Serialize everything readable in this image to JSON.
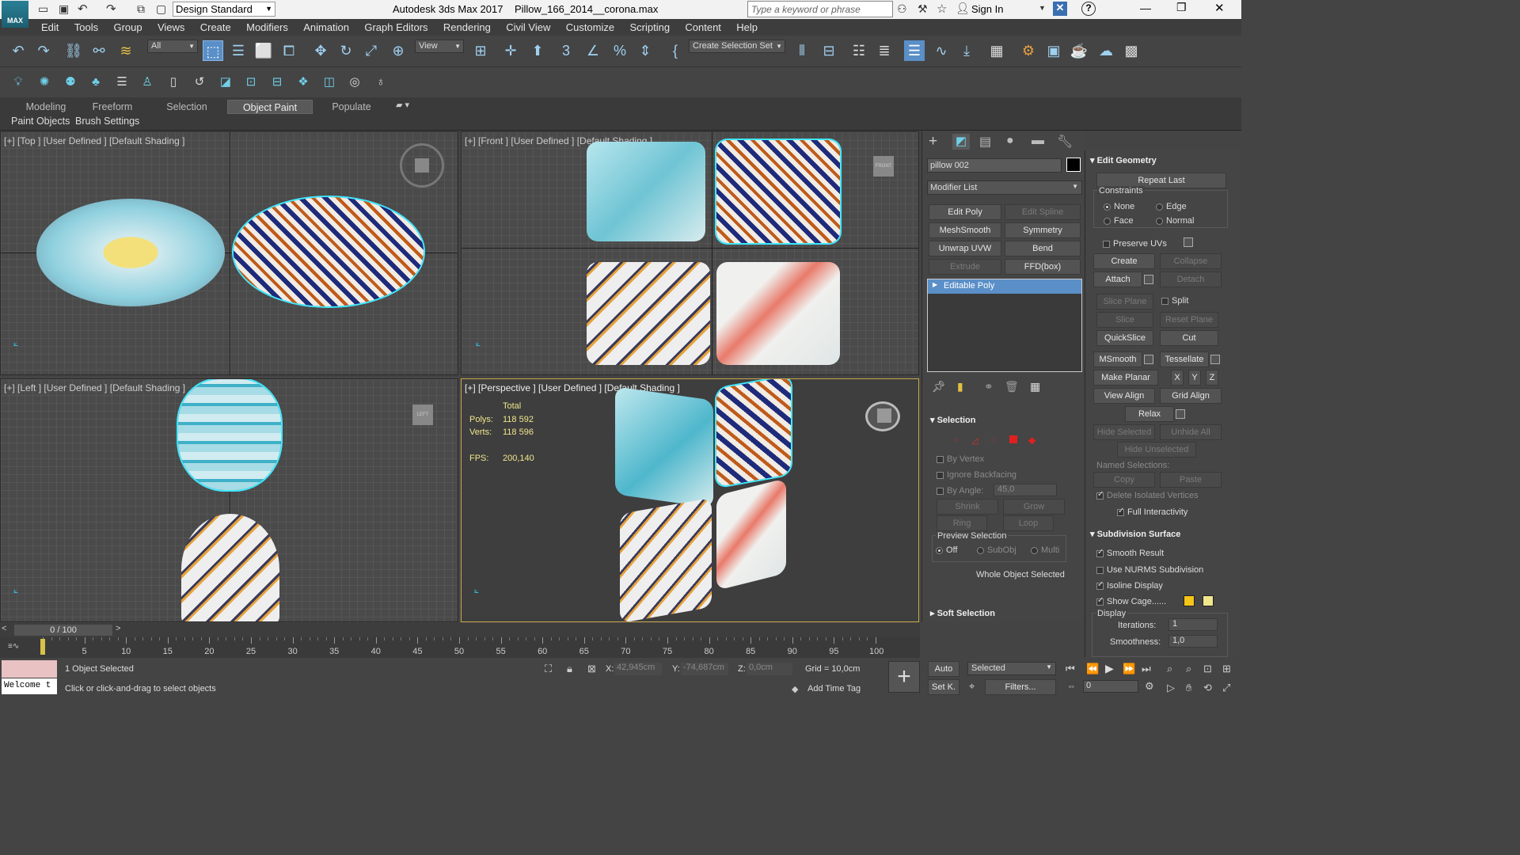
{
  "title": {
    "app_name": "Autodesk 3ds Max 2017",
    "file_name": "Pillow_166_2014__corona.max",
    "workspace": "Design Standard",
    "search_placeholder": "Type a keyword or phrase",
    "sign_in": "Sign In",
    "logo": "MAX"
  },
  "menu": [
    "Edit",
    "Tools",
    "Group",
    "Views",
    "Create",
    "Modifiers",
    "Animation",
    "Graph Editors",
    "Rendering",
    "Civil View",
    "Customize",
    "Scripting",
    "Content",
    "Help"
  ],
  "toolbar": {
    "filter_value": "All",
    "ref_coord_value": "View",
    "selection_set_value": "Create Selection Set"
  },
  "ribbon": {
    "tabs": [
      "Modeling",
      "Freeform",
      "Selection",
      "Object Paint",
      "Populate"
    ],
    "active_tab": "Object Paint",
    "subtabs": [
      "Paint Objects",
      "Brush Settings"
    ]
  },
  "viewports": {
    "top": {
      "label": "[+] [Top ] [User Defined ] [Default Shading ]"
    },
    "front": {
      "label": "[+] [Front ] [User Defined ] [Default Shading ]",
      "cube": "FRONT"
    },
    "left": {
      "label": "[+] [Left ] [User Defined ] [Default Shading ]",
      "cube": "LEFT"
    },
    "perspective": {
      "label": "[+] [Perspective ] [User Defined ] [Default Shading ]",
      "stats_header": "Total",
      "polys_label": "Polys:",
      "polys_value": "118 592",
      "verts_label": "Verts:",
      "verts_value": "118 596",
      "fps_label": "FPS:",
      "fps_value": "200,140"
    }
  },
  "command_panel": {
    "object_name": "pillow 002",
    "modifier_list": "Modifier List",
    "modifier_buttons": [
      {
        "label": "Edit Poly",
        "enabled": true
      },
      {
        "label": "Edit Spline",
        "enabled": false
      },
      {
        "label": "MeshSmooth",
        "enabled": true
      },
      {
        "label": "Symmetry",
        "enabled": true
      },
      {
        "label": "Unwrap UVW",
        "enabled": true
      },
      {
        "label": "Bend",
        "enabled": true
      },
      {
        "label": "Extrude",
        "enabled": false
      },
      {
        "label": "FFD(box)",
        "enabled": true
      }
    ],
    "stack_item": "Editable Poly",
    "selection": {
      "title": "Selection",
      "by_vertex": "By Vertex",
      "ignore_backfacing": "Ignore Backfacing",
      "by_angle": "By Angle:",
      "by_angle_value": "45,0",
      "shrink": "Shrink",
      "grow": "Grow",
      "ring": "Ring",
      "loop": "Loop",
      "preview_title": "Preview Selection",
      "preview_off": "Off",
      "preview_subobj": "SubObj",
      "preview_multi": "Multi",
      "status": "Whole Object Selected"
    },
    "soft_selection": "Soft Selection"
  },
  "edit_geometry": {
    "title": "Edit Geometry",
    "repeat_last": "Repeat Last",
    "constraints": "Constraints",
    "c_none": "None",
    "c_edge": "Edge",
    "c_face": "Face",
    "c_normal": "Normal",
    "preserve_uvs": "Preserve UVs",
    "create": "Create",
    "collapse": "Collapse",
    "attach": "Attach",
    "detach": "Detach",
    "slice_plane": "Slice Plane",
    "split": "Split",
    "slice": "Slice",
    "reset_plane": "Reset Plane",
    "quickslice": "QuickSlice",
    "cut": "Cut",
    "msmooth": "MSmooth",
    "tessellate": "Tessellate",
    "make_planar": "Make Planar",
    "x": "X",
    "y": "Y",
    "z": "Z",
    "view_align": "View Align",
    "grid_align": "Grid Align",
    "relax": "Relax",
    "hide_selected": "Hide Selected",
    "unhide_all": "Unhide All",
    "hide_unselected": "Hide Unselected",
    "named_selections": "Named Selections:",
    "copy": "Copy",
    "paste": "Paste",
    "delete_isolated": "Delete Isolated Vertices",
    "full_interactivity": "Full Interactivity"
  },
  "subdivision": {
    "title": "Subdivision Surface",
    "smooth_result": "Smooth Result",
    "use_nurms": "Use NURMS Subdivision",
    "isoline_display": "Isoline Display",
    "show_cage": "Show Cage......",
    "display": "Display",
    "iterations_label": "Iterations:",
    "iterations_value": "1",
    "smoothness_label": "Smoothness:",
    "smoothness_value": "1,0",
    "cage_color_1": "#f5c518",
    "cage_color_2": "#f0e68c"
  },
  "timeline": {
    "frame_counter": "0 / 100",
    "ticks": [
      "0",
      "5",
      "10",
      "15",
      "20",
      "25",
      "30",
      "35",
      "40",
      "45",
      "50",
      "55",
      "60",
      "65",
      "70",
      "75",
      "80",
      "85",
      "90",
      "95",
      "100"
    ]
  },
  "status": {
    "maxscript": "Welcome t",
    "selected": "1 Object Selected",
    "prompt": "Click or click-and-drag to select objects",
    "x_label": "X:",
    "x_value": "42,945cm",
    "y_label": "Y:",
    "y_value": "-74,687cm",
    "z_label": "Z:",
    "z_value": "0,0cm",
    "grid": "Grid = 10,0cm",
    "add_time_tag": "Add Time Tag",
    "auto": "Auto",
    "set_k": "Set K.",
    "selected_dropdown": "Selected",
    "filters": "Filters...",
    "frame_value": "0"
  }
}
